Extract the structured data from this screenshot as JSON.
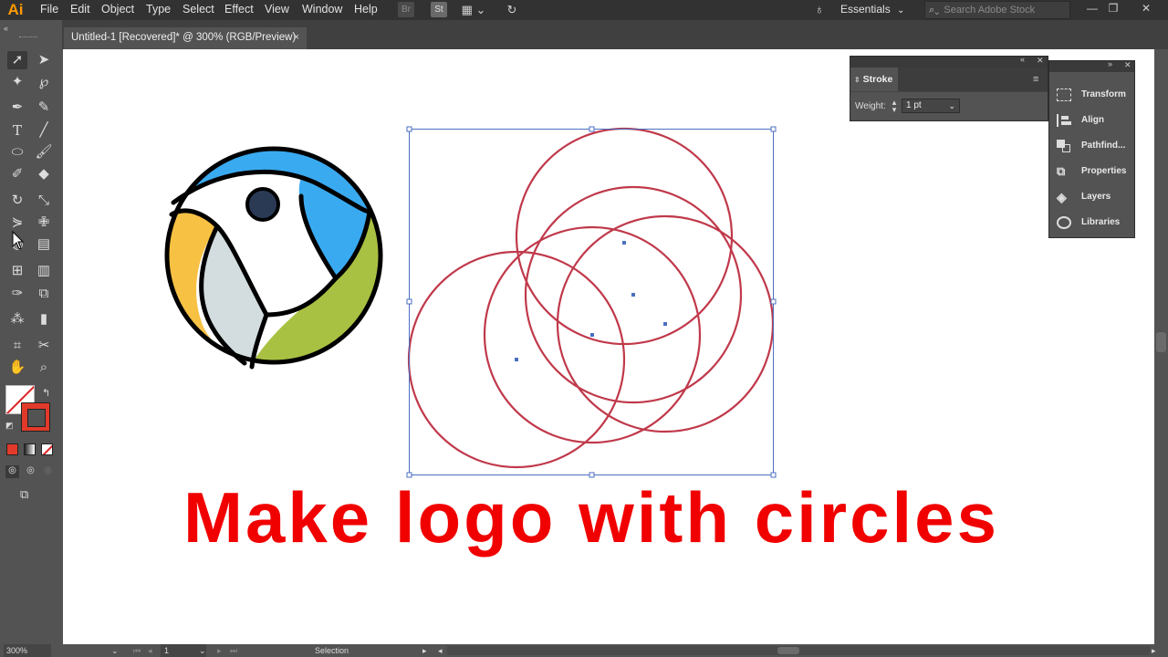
{
  "app": {
    "logo": "Ai",
    "menu": [
      "File",
      "Edit",
      "Object",
      "Type",
      "Select",
      "Effect",
      "View",
      "Window",
      "Help"
    ],
    "br_icon": "Br",
    "st_icon": "St",
    "workspace": "Essentials",
    "search_placeholder": "Search Adobe Stock"
  },
  "document": {
    "tab_title": "Untitled-1 [Recovered]* @ 300% (RGB/Preview)",
    "close": "×"
  },
  "stroke_panel": {
    "title": "Stroke",
    "weight_label": "Weight:",
    "weight_value": "1 pt"
  },
  "side_panel": {
    "items": [
      {
        "label": "Transform",
        "icon": "transform-icon"
      },
      {
        "label": "Align",
        "icon": "align-icon"
      },
      {
        "label": "Pathfind...",
        "icon": "pathfinder-icon"
      },
      {
        "label": "Properties",
        "icon": "properties-icon"
      },
      {
        "label": "Layers",
        "icon": "layers-icon"
      },
      {
        "label": "Libraries",
        "icon": "libraries-icon"
      }
    ]
  },
  "status": {
    "zoom": "300%",
    "artboard": "1",
    "tool": "Selection"
  },
  "headline": "Make logo with circles",
  "colors": {
    "stroke_red": "#c0394b",
    "selection_blue": "#4b6fc1",
    "parrot_blue": "#3aaaf0",
    "parrot_green": "#a9c142",
    "parrot_yellow": "#f7c144",
    "parrot_gray": "#d3dde0",
    "eye": "#2a3a55",
    "headline_red": "#f10000"
  }
}
